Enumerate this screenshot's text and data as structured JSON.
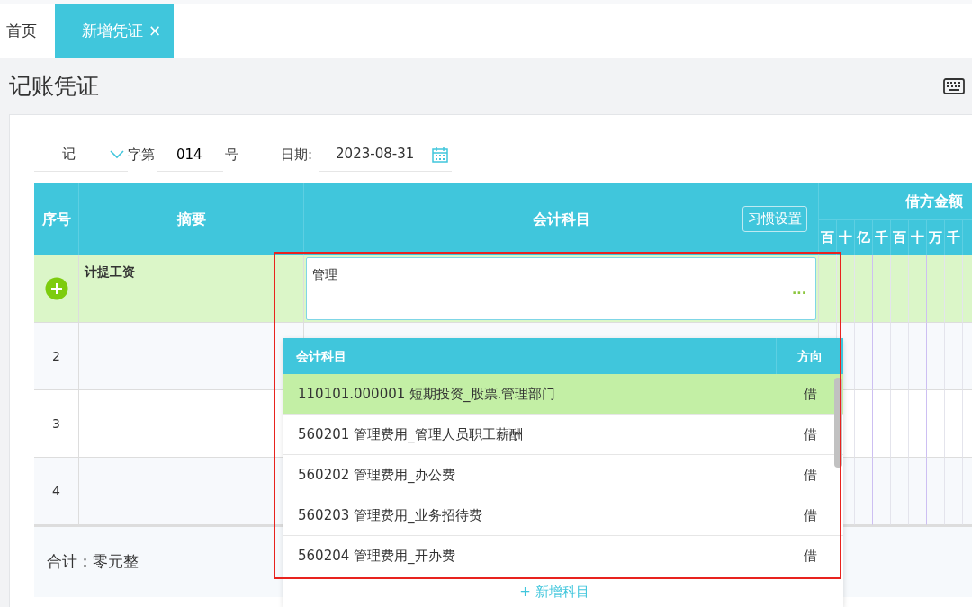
{
  "tabs": [
    {
      "label": "首页",
      "selected": false
    },
    {
      "label": "新增凭证",
      "selected": true,
      "close_glyph": "×"
    }
  ],
  "page_title": "记账凭证",
  "form": {
    "voucher_type": "记",
    "label_before_number": "字第",
    "number": "014",
    "label_after_number": "号",
    "date_label": "日期:",
    "date": "2023-08-31"
  },
  "table": {
    "columns": [
      "序号",
      "摘要",
      "会计科目",
      "借方金额"
    ],
    "settings_button": "习惯设置",
    "digit_units": [
      "百",
      "十",
      "亿",
      "千",
      "百",
      "十",
      "万",
      "千"
    ],
    "rows": [
      {
        "kind": "active",
        "summary": "计提工资",
        "subject_input": "管理",
        "more_glyph": "···"
      },
      {
        "kind": "plain",
        "index": "2"
      },
      {
        "kind": "plain",
        "index": "3"
      },
      {
        "kind": "plain",
        "index": "4"
      }
    ],
    "total": "合计：零元整"
  },
  "dropdown": {
    "columns": [
      "会计科目",
      "方向"
    ],
    "items": [
      {
        "subject": "110101.000001 短期投资_股票.管理部门",
        "direction": "借",
        "selected": true
      },
      {
        "subject": "560201 管理费用_管理人员职工薪酬",
        "direction": "借",
        "selected": false
      },
      {
        "subject": "560202 管理费用_办公费",
        "direction": "借",
        "selected": false
      },
      {
        "subject": "560203 管理费用_业务招待费",
        "direction": "借",
        "selected": false
      },
      {
        "subject": "560204 管理费用_开办费",
        "direction": "借",
        "selected": false
      }
    ],
    "add_glyph": "+",
    "add_label": "新增科目"
  }
}
